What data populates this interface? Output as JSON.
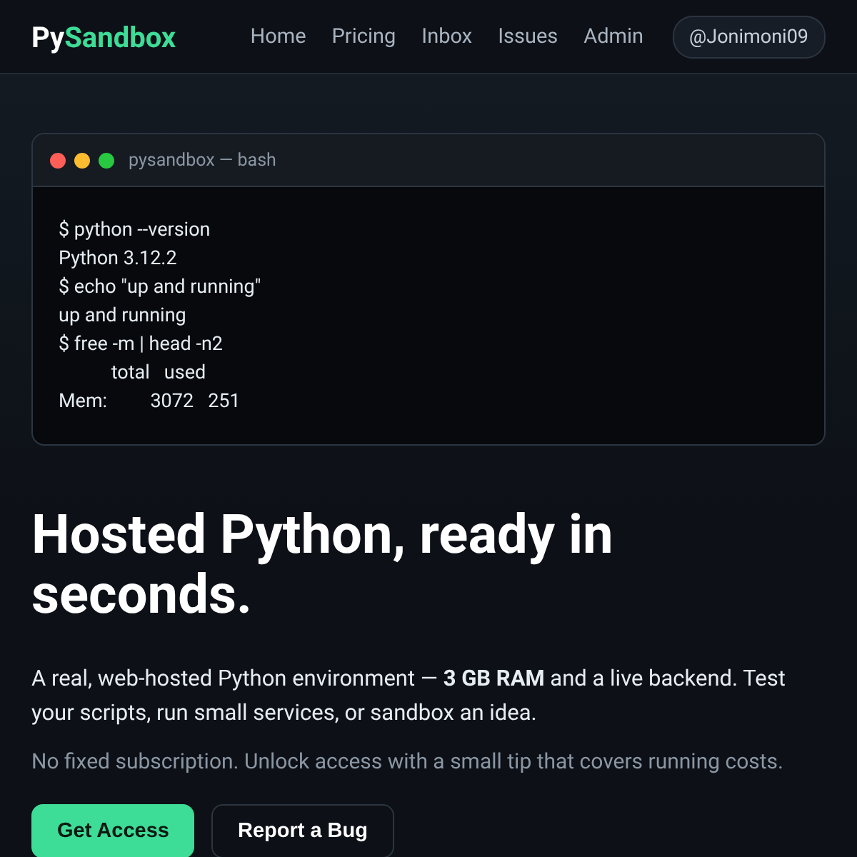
{
  "navbar": {
    "logo": {
      "prefix": "Py",
      "accent": "Sandbox"
    },
    "links": [
      {
        "label": "Home"
      },
      {
        "label": "Pricing"
      },
      {
        "label": "Inbox"
      },
      {
        "label": "Issues"
      },
      {
        "label": "Admin"
      }
    ],
    "user": "@Jonimoni09"
  },
  "terminal": {
    "title": "pysandbox — bash",
    "lines": [
      "$ python --version",
      "Python 3.12.2",
      "$ echo \"up and running\"",
      "up and running",
      "$ free -m | head -n2",
      "           total   used",
      "Mem:         3072   251"
    ]
  },
  "hero": {
    "heading": "Hosted Python, ready in seconds.",
    "description": "A real, web-hosted Python environment — **3 GB RAM** and a live backend. Test your scripts, run small services, or sandbox an idea.",
    "note": "No fixed subscription. Unlock access with a small tip that covers running costs.",
    "buttons": [
      {
        "label": "Get Access",
        "kind": "primary"
      },
      {
        "label": "Report a Bug",
        "kind": "secondary"
      }
    ]
  }
}
